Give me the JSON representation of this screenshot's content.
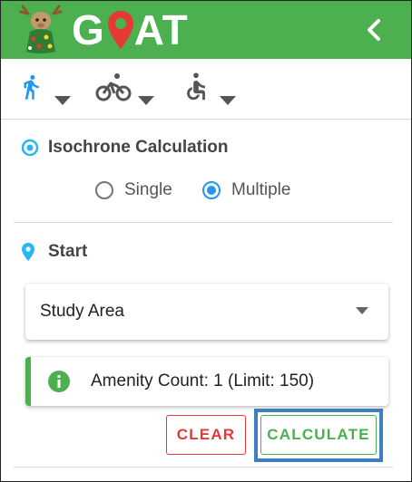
{
  "header": {
    "brand_left": "G",
    "brand_right": "AT",
    "collapse_icon": "chevron-left-icon"
  },
  "travel_modes": [
    {
      "name": "walking",
      "icon": "walk-icon",
      "active": true
    },
    {
      "name": "bicycle",
      "icon": "bicycle-icon",
      "active": false
    },
    {
      "name": "wheelchair",
      "icon": "wheelchair-icon",
      "active": false
    }
  ],
  "isochrone": {
    "title": "Isochrone Calculation",
    "options": [
      "Single",
      "Multiple"
    ],
    "selected": "Multiple"
  },
  "start": {
    "title": "Start",
    "select_value": "Study Area"
  },
  "alert": {
    "text": "Amenity Count: 1 (Limit: 150)"
  },
  "actions": {
    "clear_label": "CLEAR",
    "calculate_label": "CALCULATE"
  },
  "colors": {
    "brand_green": "#4caf50",
    "accent_blue": "#2196f3",
    "clear_red": "#e53935",
    "focus_blue": "#3d7fc1"
  }
}
